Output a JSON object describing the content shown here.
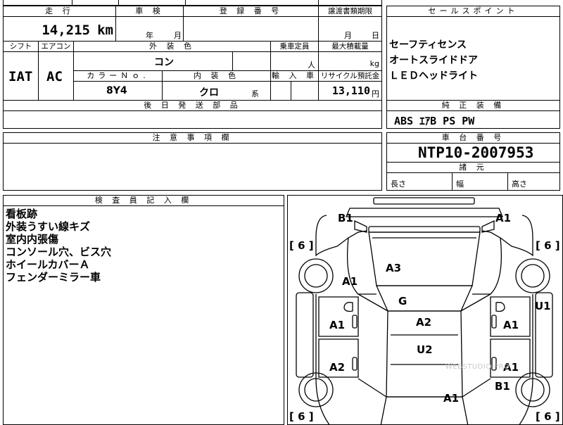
{
  "mileage": {
    "label": "走 行",
    "value": "14,215",
    "unit": "km"
  },
  "inspection": {
    "label": "車 検",
    "year_unit": "年",
    "month_unit": "月"
  },
  "registration": {
    "label": "登 録 番 号"
  },
  "transfer_deadline": {
    "label": "譲渡書類期限",
    "month_unit": "月",
    "day_unit": "日"
  },
  "sales_points": {
    "label": "セールスポイント",
    "items": [
      "セーフティセンス",
      "オートスライドドア",
      "ＬＥＤヘッドライト"
    ]
  },
  "shift": {
    "label": "シフト",
    "value": "IAT"
  },
  "aircon": {
    "label": "エアコン",
    "value": "AC"
  },
  "exterior_color": {
    "label": "外 装 色",
    "value": "コン"
  },
  "capacity": {
    "label": "乗車定員",
    "unit": "人"
  },
  "max_load": {
    "label": "最大積載量",
    "unit": "kg"
  },
  "color_no": {
    "label": "カラーＮｏ.",
    "value": "8Y4"
  },
  "interior_color": {
    "label": "内 装 色",
    "value": "クロ",
    "suffix": "系"
  },
  "import_car": {
    "label": "輸 入 車"
  },
  "recycle_fee": {
    "label": "リサイクル預託金",
    "value": "13,110",
    "unit": "円"
  },
  "later_parts": {
    "label": "後 日 発 送 部 品"
  },
  "standard_equipment": {
    "label": "純 正 装 備",
    "value": "ABS ｴｱB PS PW"
  },
  "caution": {
    "label": "注 意 事 項 欄"
  },
  "chassis": {
    "label": "車 台 番 号",
    "value": "NTP10-2007953"
  },
  "specs": {
    "label": "諸 元",
    "length": "長さ",
    "width": "幅",
    "height": "高さ"
  },
  "inspector_notes": {
    "label": "検 査 員 記 入 欄",
    "lines": [
      "看板跡",
      "外装うすい線キズ",
      "室内内張傷",
      "コンソール穴、ビス穴",
      "ホイールカバーＡ",
      "フェンダーミラー車"
    ]
  },
  "diagram": {
    "tread_fl": "[ 6 ]",
    "tread_fr": "[ 6 ]",
    "tread_rl": "[ 6 ]",
    "tread_rr": "[ 6 ]",
    "marks": {
      "front_bumper_left": "B1",
      "front_bumper_right": "A1",
      "hood": "A3",
      "front_fender_left": "A1",
      "roof": "G",
      "pillar_right": "U1",
      "front_door_left": "A1",
      "front_door_right": "A1",
      "roof_center": "A2",
      "rear_door_left": "A2",
      "rear_door_right": "A1",
      "roof_rear": "U2",
      "rear_fender_right": "B1",
      "rear_gate": "A1"
    },
    "watermark": "WEBSTUDIO.PRO"
  }
}
